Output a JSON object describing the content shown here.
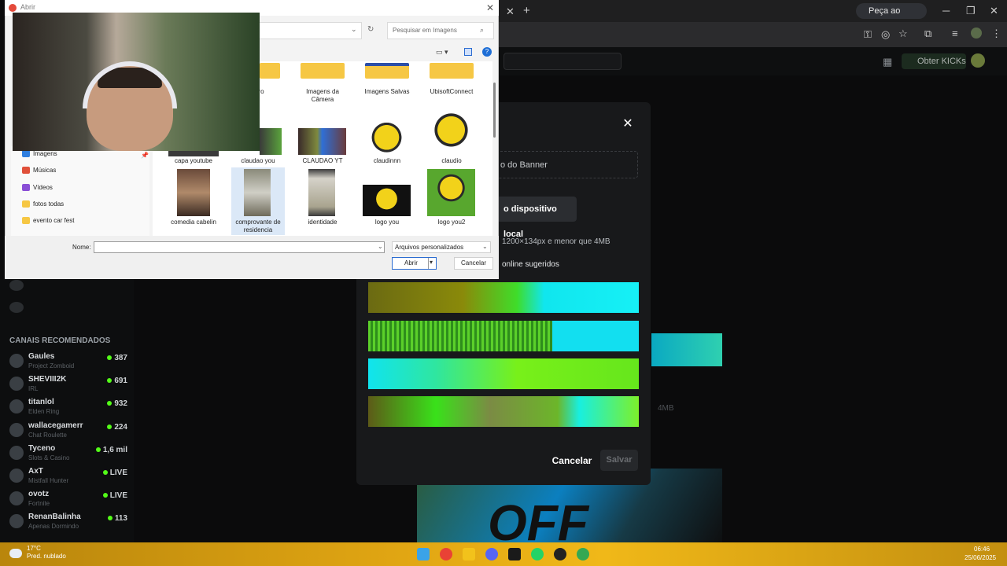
{
  "browser": {
    "gemini_button": "Peça ao Gemini",
    "minimize": "─",
    "restore": "❐",
    "close": "✕",
    "new_tab": "+"
  },
  "site": {
    "kicks_button": "Obter KICKs",
    "accent": "#53fc18"
  },
  "sidebar": {
    "section_title": "CANAIS RECOMENDADOS",
    "channels": [
      {
        "name": "Gaules",
        "category": "Project Zomboid",
        "count": "387"
      },
      {
        "name": "SHEVIII2K",
        "category": "IRL",
        "count": "691"
      },
      {
        "name": "titanlol",
        "category": "Elden Ring",
        "count": "932"
      },
      {
        "name": "wallacegamerr",
        "category": "Chat Roulette",
        "count": "224"
      },
      {
        "name": "Tyceno",
        "category": "Slots & Casino",
        "count": "1,6 mil"
      },
      {
        "name": "AxT",
        "category": "Mistfall Hunter",
        "count": "LIVE"
      },
      {
        "name": "ovotz",
        "category": "Fortnite",
        "count": "LIVE"
      },
      {
        "name": "RenanBalinha",
        "category": "Apenas Dormindo",
        "count": "113"
      }
    ]
  },
  "background": {
    "hint": "4MB"
  },
  "modal": {
    "field_text": "o do Banner",
    "upload_button": "o dispositivo local",
    "size_hint": "1200×134px e menor que 4MB",
    "suggested_label": "online sugeridos",
    "cancel": "Cancelar",
    "save": "Salvar"
  },
  "dialog": {
    "title": "Abrir",
    "search_placeholder": "Pesquisar em Imagens",
    "name_label": "Nome:",
    "name_value": "",
    "file_type": "Arquivos personalizados",
    "open_button": "Abrir",
    "cancel_button": "Cancelar",
    "nav": [
      {
        "label": "Imagens",
        "color": "#2f7fe0"
      },
      {
        "label": "Músicas",
        "color": "#e0503a"
      },
      {
        "label": "Vídeos",
        "color": "#8a4fd6"
      },
      {
        "label": "fotos todas",
        "color": "#f6c744"
      },
      {
        "label": "evento car fest",
        "color": "#f6c744"
      }
    ],
    "files_row1": [
      "ro",
      "Imagens da Câmera",
      "Imagens Salvas",
      "UbisoftConnect"
    ],
    "files_row2": [
      "capa youtube",
      "claudao you",
      "CLAUDAO YT",
      "claudinnn",
      "claudio"
    ],
    "files_row3": [
      "comedia cabelin",
      "comprovante de residencia",
      "identidade",
      "logo you",
      "logo you2"
    ]
  },
  "taskbar": {
    "temp": "17°C",
    "weather": "Pred. nublado",
    "time": "06:46",
    "date": "25/06/2025"
  }
}
